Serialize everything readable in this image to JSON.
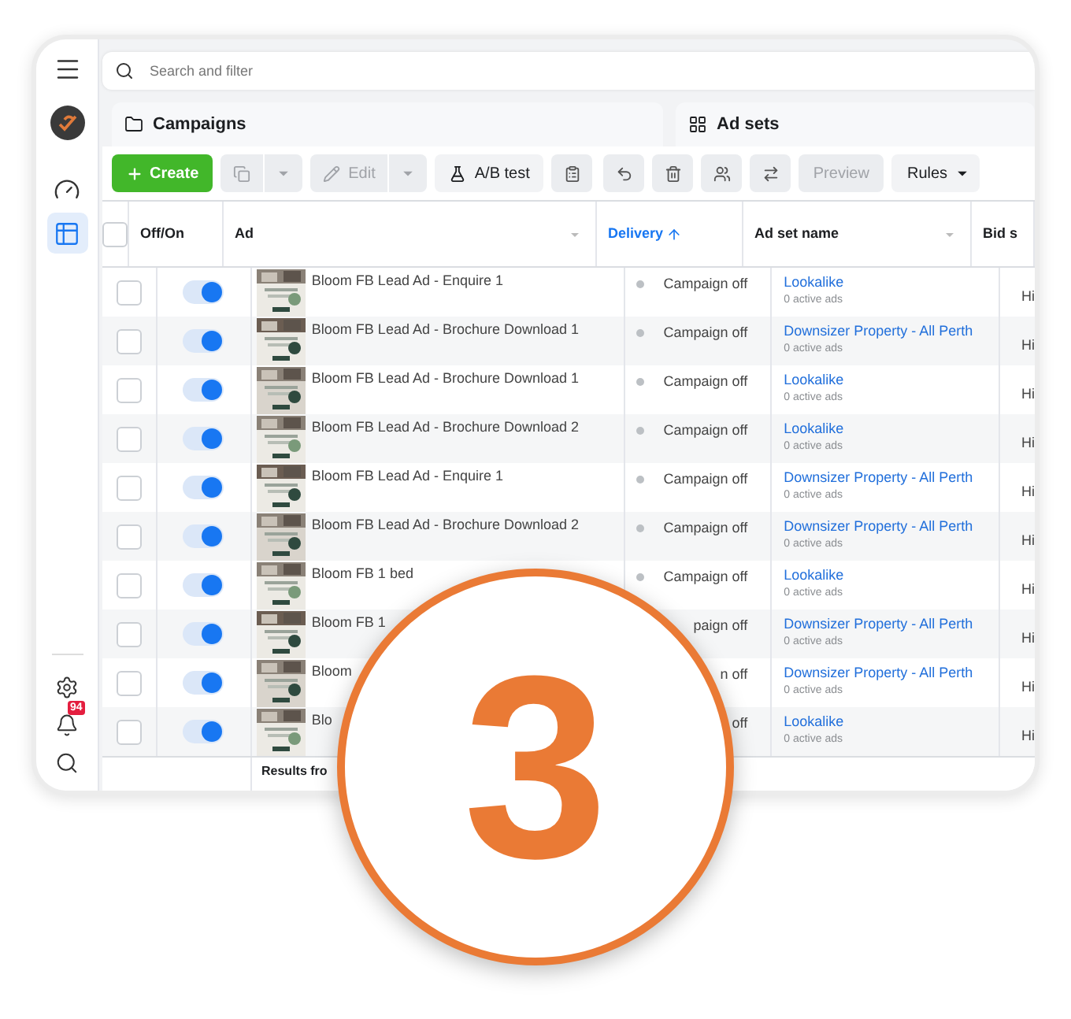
{
  "sidebar": {
    "top": [
      {
        "kind": "menu"
      },
      {
        "kind": "avatar"
      },
      {
        "kind": "gauge",
        "selected": false
      },
      {
        "kind": "table",
        "selected": true
      }
    ],
    "bottom": [
      {
        "kind": "settings"
      },
      {
        "kind": "bell",
        "badge": "94"
      },
      {
        "kind": "search"
      }
    ]
  },
  "search": {
    "placeholder": "Search and filter"
  },
  "tabs": [
    {
      "kind": "campaigns",
      "label": "Campaigns"
    },
    {
      "kind": "adsets",
      "label": "Ad sets"
    }
  ],
  "toolbar": [
    {
      "kind": "primary",
      "label": "Create",
      "disabled": false
    },
    {
      "kind": "split",
      "disabled": true
    },
    {
      "kind": "split",
      "label": "Edit",
      "disabled": true
    },
    {
      "kind": "button",
      "label": "A/B test",
      "disabled": false
    },
    {
      "kind": "icon",
      "disabled": false
    },
    {
      "kind": "icon",
      "disabled": false
    },
    {
      "kind": "icon",
      "disabled": false
    },
    {
      "kind": "icon",
      "disabled": false
    },
    {
      "kind": "icon",
      "disabled": false
    },
    {
      "kind": "button",
      "label": "Preview",
      "disabled": true
    },
    {
      "kind": "menu",
      "label": "Rules",
      "disabled": false
    }
  ],
  "table": {
    "header_checked": false,
    "columns": [
      {
        "label": "Off/On",
        "sorted": false,
        "menu": false
      },
      {
        "label": "Ad",
        "sorted": false,
        "menu": true
      },
      {
        "label": "Delivery",
        "sorted": true,
        "menu": false
      },
      {
        "label": "Ad set name",
        "sorted": false,
        "menu": true
      },
      {
        "label": "Bid s",
        "sorted": false,
        "menu": false
      }
    ],
    "rows": [
      {
        "checked": false,
        "on": true,
        "ad": "Bloom FB Lead Ad - Enquire 1",
        "delivery": "Campaign off",
        "adset": "Lookalike",
        "adset_note": "0 active ads",
        "bid": "Hi"
      },
      {
        "checked": false,
        "on": true,
        "ad": "Bloom FB Lead Ad - Brochure Download 1",
        "delivery": "Campaign off",
        "adset": "Downsizer Property - All Perth",
        "adset_note": "0 active ads",
        "bid": "Hi"
      },
      {
        "checked": false,
        "on": true,
        "ad": "Bloom FB Lead Ad - Brochure Download 1",
        "delivery": "Campaign off",
        "adset": "Lookalike",
        "adset_note": "0 active ads",
        "bid": "Hi"
      },
      {
        "checked": false,
        "on": true,
        "ad": "Bloom FB Lead Ad - Brochure Download 2",
        "delivery": "Campaign off",
        "adset": "Lookalike",
        "adset_note": "0 active ads",
        "bid": "Hi"
      },
      {
        "checked": false,
        "on": true,
        "ad": "Bloom FB Lead Ad - Enquire 1",
        "delivery": "Campaign off",
        "adset": "Downsizer Property - All Perth",
        "adset_note": "0 active ads",
        "bid": "Hi"
      },
      {
        "checked": false,
        "on": true,
        "ad": "Bloom FB Lead Ad - Brochure Download 2",
        "delivery": "Campaign off",
        "adset": "Downsizer Property - All Perth",
        "adset_note": "0 active ads",
        "bid": "Hi"
      },
      {
        "checked": false,
        "on": true,
        "ad": "Bloom FB 1 bed",
        "delivery": "Campaign off",
        "adset": "Lookalike",
        "adset_note": "0 active ads",
        "bid": "Hi"
      },
      {
        "checked": false,
        "on": true,
        "ad": "Bloom FB 1",
        "delivery": "paign off",
        "adset": "Downsizer Property - All Perth",
        "adset_note": "0 active ads",
        "bid": "Hi"
      },
      {
        "checked": false,
        "on": true,
        "ad": "Bloom",
        "delivery": "n off",
        "adset": "Downsizer Property - All Perth",
        "adset_note": "0 active ads",
        "bid": "Hi"
      },
      {
        "checked": false,
        "on": true,
        "ad": "Blo",
        "delivery": "off",
        "adset": "Lookalike",
        "adset_note": "0 active ads",
        "bid": "Hi"
      }
    ],
    "footer": "Results fro"
  },
  "step": {
    "label": "3"
  }
}
